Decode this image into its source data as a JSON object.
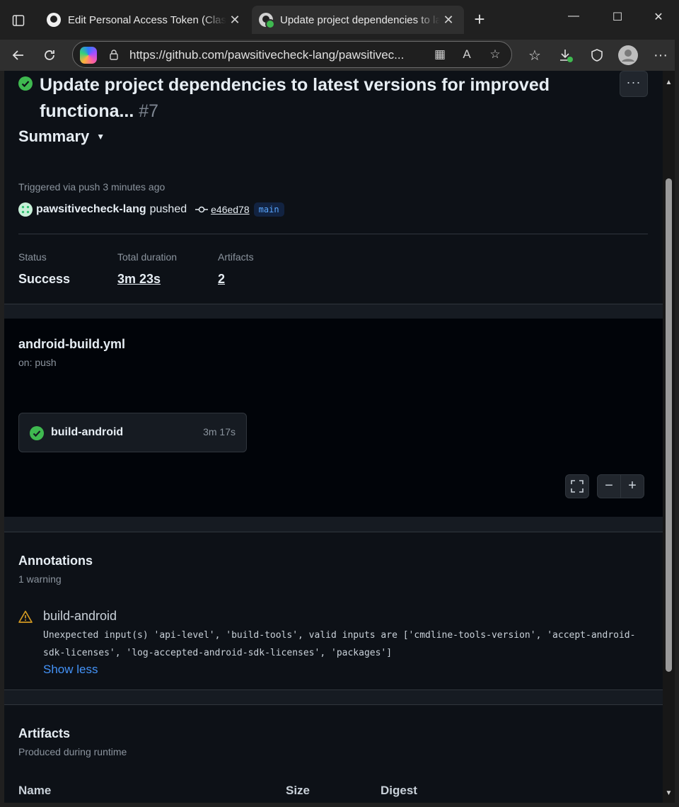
{
  "browser": {
    "tabs": [
      {
        "title": "Edit Personal Access Token (Classic)"
      },
      {
        "title": "Update project dependencies to latest versions"
      }
    ],
    "url": "https://github.com/pawsitivecheck-lang/pawsitivec..."
  },
  "run": {
    "title": "Update project dependencies to latest versions for improved functiona...",
    "number": "#7",
    "more_label": "···",
    "summary_label": "Summary",
    "triggered": "Triggered via push 3 minutes ago",
    "user": "pawsitivecheck-lang",
    "action": "pushed",
    "sha": "e46ed78",
    "branch": "main"
  },
  "stats": {
    "status_label": "Status",
    "status_value": "Success",
    "duration_label": "Total duration",
    "duration_value": "3m 23s",
    "artifacts_label": "Artifacts",
    "artifacts_value": "2"
  },
  "workflow": {
    "name": "android-build.yml",
    "trigger": "on: push",
    "job_name": "build-android",
    "job_duration": "3m 17s",
    "zoom_out": "−",
    "zoom_in": "+"
  },
  "annotations": {
    "title": "Annotations",
    "count": "1 warning",
    "item_title": "build-android",
    "item_message": "Unexpected input(s) 'api-level', 'build-tools', valid inputs are ['cmdline-tools-version', 'accept-android-sdk-licenses', 'log-accepted-android-sdk-licenses', 'packages']",
    "toggle_label": "Show less"
  },
  "artifacts": {
    "title": "Artifacts",
    "subtitle": "Produced during runtime",
    "columns": [
      "Name",
      "Size",
      "Digest"
    ]
  },
  "colors": {
    "success": "#3fb950",
    "warning": "#d29922",
    "link": "#4493f8",
    "background": "#0d1117"
  }
}
